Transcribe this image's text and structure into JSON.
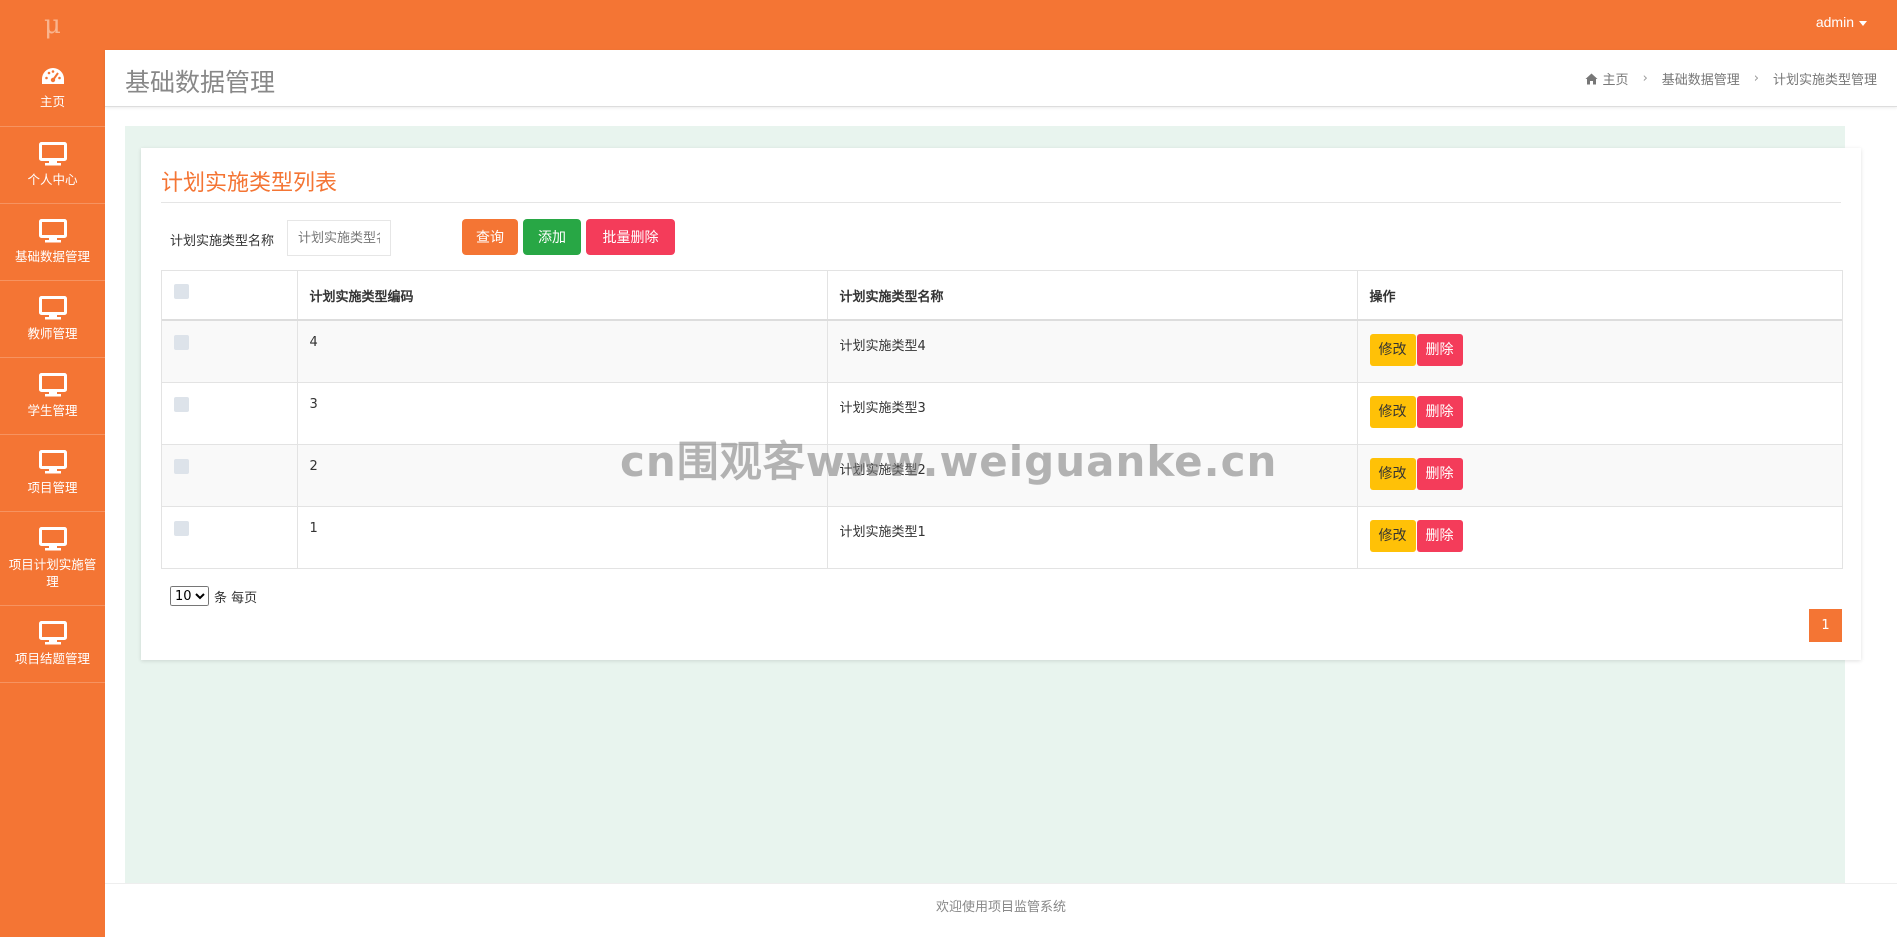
{
  "app": {
    "logo": "μ",
    "user": "admin"
  },
  "sidebar": {
    "items": [
      {
        "label": "主页",
        "icon": "dashboard-icon"
      },
      {
        "label": "个人中心",
        "icon": "monitor-icon"
      },
      {
        "label": "基础数据管理",
        "icon": "monitor-icon"
      },
      {
        "label": "教师管理",
        "icon": "monitor-icon"
      },
      {
        "label": "学生管理",
        "icon": "monitor-icon"
      },
      {
        "label": "项目管理",
        "icon": "monitor-icon"
      },
      {
        "label": "项目计划实施管理",
        "icon": "monitor-icon"
      },
      {
        "label": "项目结题管理",
        "icon": "monitor-icon"
      }
    ]
  },
  "header": {
    "title": "基础数据管理",
    "breadcrumb": [
      "主页",
      "基础数据管理",
      "计划实施类型管理"
    ]
  },
  "card": {
    "title": "计划实施类型列表",
    "search_label": "计划实施类型名称",
    "search_placeholder": "计划实施类型名称",
    "search_value": "",
    "query_label": "查询",
    "add_label": "添加",
    "batch_delete_label": "批量删除"
  },
  "table": {
    "columns": [
      "计划实施类型编码",
      "计划实施类型名称",
      "操作"
    ],
    "rows": [
      {
        "code": "4",
        "name": "计划实施类型4"
      },
      {
        "code": "3",
        "name": "计划实施类型3"
      },
      {
        "code": "2",
        "name": "计划实施类型2"
      },
      {
        "code": "1",
        "name": "计划实施类型1"
      }
    ],
    "edit_label": "修改",
    "delete_label": "删除"
  },
  "pagination": {
    "page_size": "10",
    "page_size_suffix": "条 每页",
    "current_page": "1"
  },
  "footer": {
    "text": "欢迎使用项目监管系统"
  },
  "watermark": "cn围观客www.weiguanke.cn",
  "colors": {
    "primary": "#f47534",
    "success": "#28a745",
    "danger": "#f43c5a",
    "warning": "#ffc107"
  }
}
